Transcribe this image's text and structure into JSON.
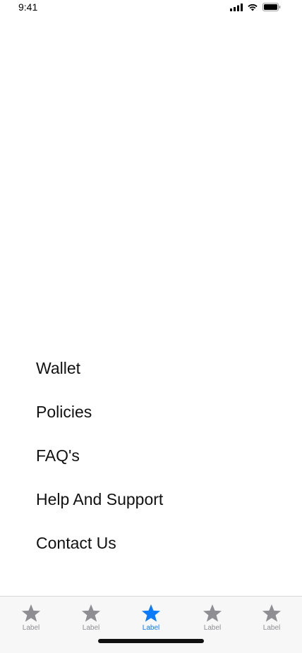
{
  "status_bar": {
    "time": "9:41",
    "icons": [
      "signal-icon",
      "wifi-icon",
      "battery-icon"
    ]
  },
  "menu": {
    "items": [
      {
        "label": "Wallet"
      },
      {
        "label": "Policies"
      },
      {
        "label": "FAQ's"
      },
      {
        "label": "Help And Support"
      },
      {
        "label": "Contact Us"
      }
    ]
  },
  "tab_bar": {
    "active_color": "#0a7aff",
    "inactive_color": "#8e8e93",
    "tabs": [
      {
        "label": "Label",
        "icon": "star-icon",
        "active": false
      },
      {
        "label": "Label",
        "icon": "star-icon",
        "active": false
      },
      {
        "label": "Label",
        "icon": "star-icon",
        "active": true
      },
      {
        "label": "Label",
        "icon": "star-icon",
        "active": false
      },
      {
        "label": "Label",
        "icon": "star-icon",
        "active": false
      }
    ]
  }
}
